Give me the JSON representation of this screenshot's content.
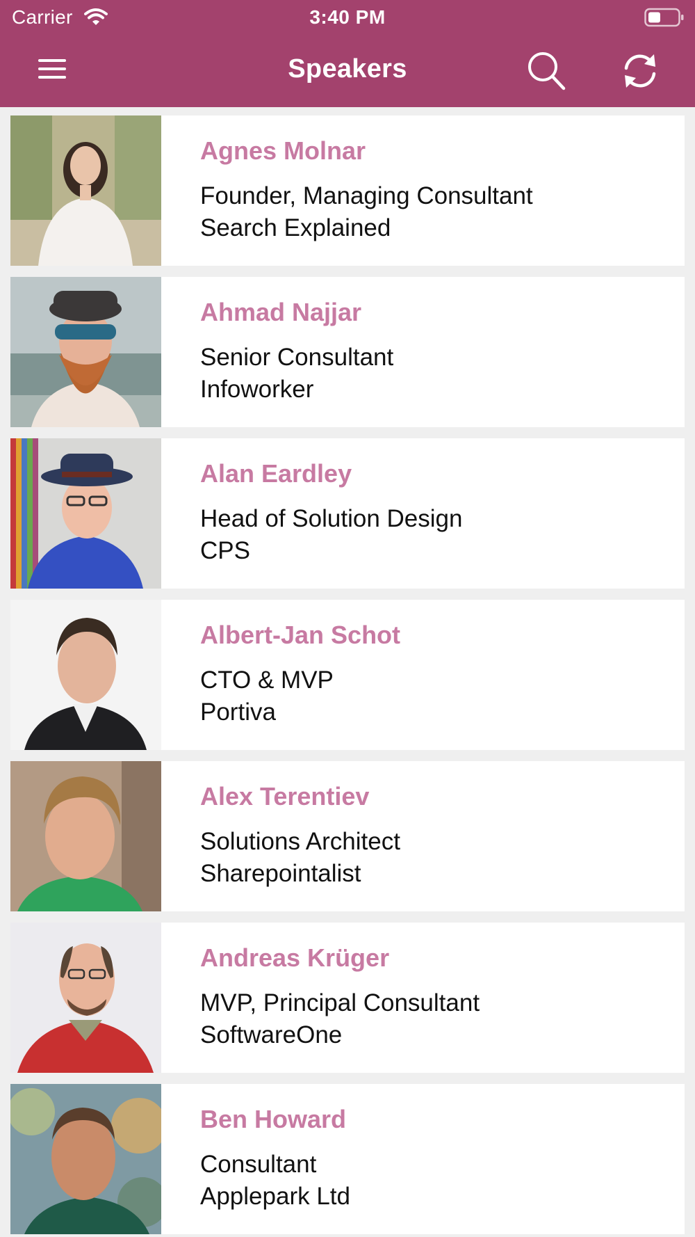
{
  "status_bar": {
    "carrier": "Carrier",
    "time": "3:40 PM"
  },
  "nav": {
    "title": "Speakers",
    "menu_icon": "hamburger-menu-icon",
    "search_icon": "search-icon",
    "refresh_icon": "refresh-icon"
  },
  "colors": {
    "brand": "#a3426d",
    "name_text": "#c77aa2",
    "background": "#efefef"
  },
  "speakers": [
    {
      "name": "Agnes Molnar",
      "role": "Founder, Managing Consultant",
      "company": "Search Explained"
    },
    {
      "name": "Ahmad Najjar",
      "role": "Senior Consultant",
      "company": "Infoworker"
    },
    {
      "name": "Alan Eardley",
      "role": "Head of Solution Design",
      "company": "CPS"
    },
    {
      "name": "Albert-Jan Schot",
      "role": "CTO & MVP",
      "company": "Portiva"
    },
    {
      "name": "Alex Terentiev",
      "role": "Solutions Architect",
      "company": "Sharepointalist"
    },
    {
      "name": "Andreas Krüger",
      "role": "MVP, Principal Consultant",
      "company": "SoftwareOne"
    },
    {
      "name": "Ben Howard",
      "role": "Consultant",
      "company": "Applepark Ltd"
    }
  ]
}
